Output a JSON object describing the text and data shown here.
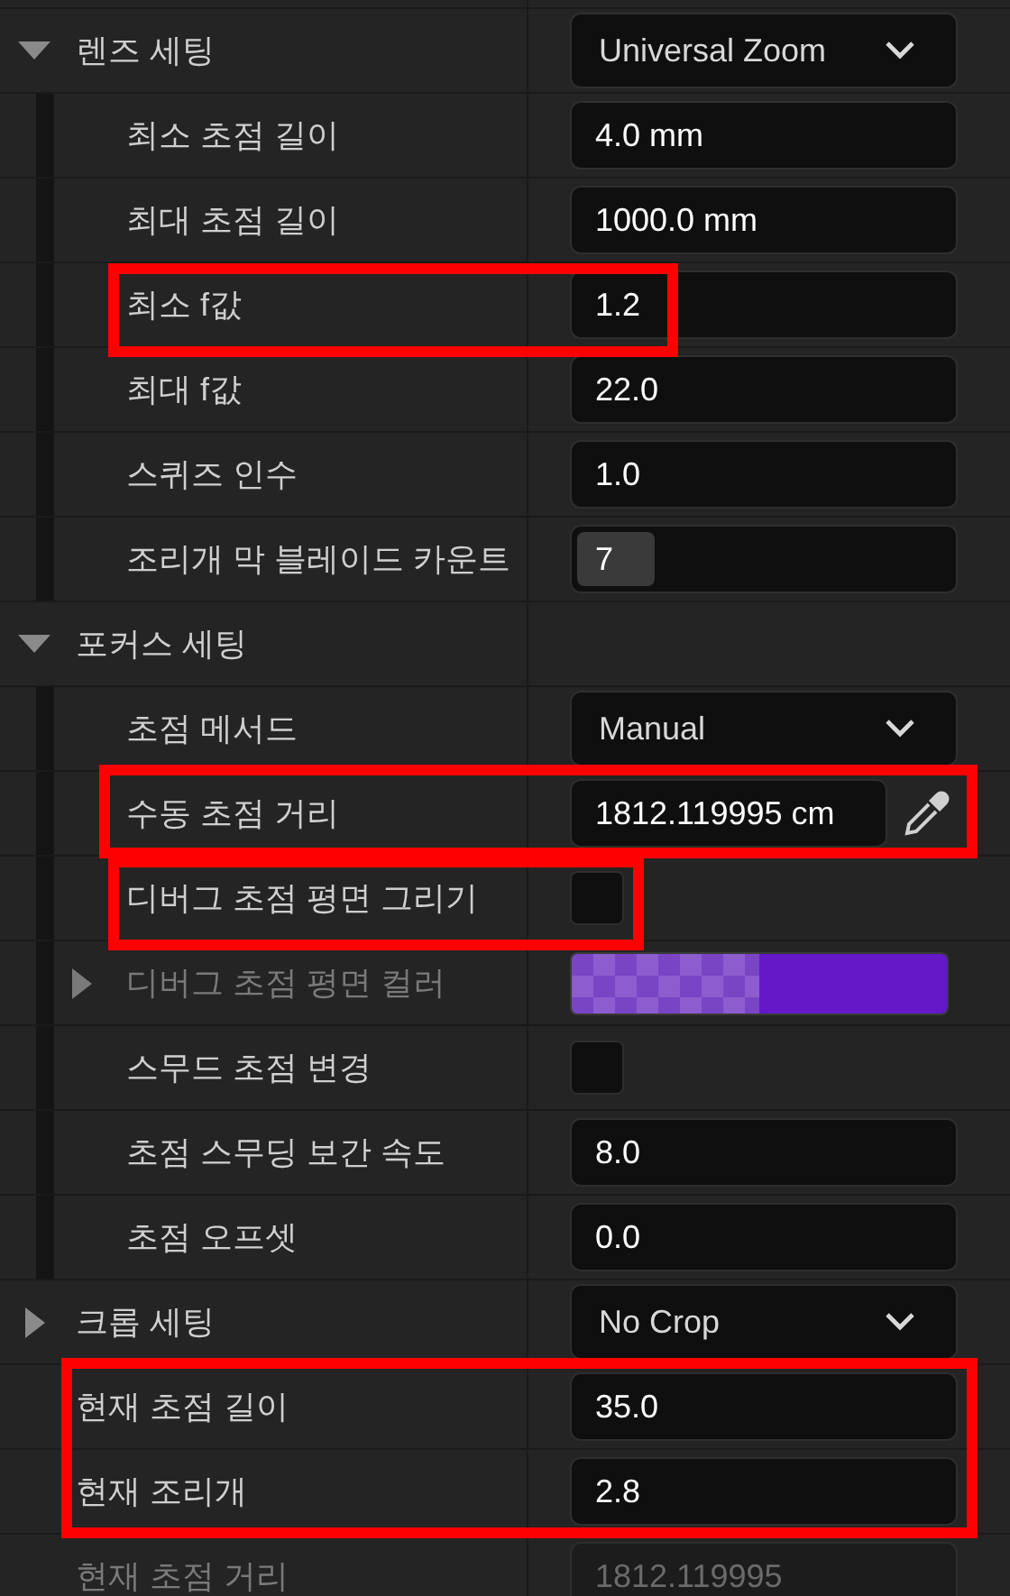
{
  "items": [
    {
      "kind": "section",
      "label": "렌즈 세팅",
      "expanded": true,
      "value": {
        "kind": "dropdown",
        "text": "Universal Zoom"
      },
      "rows": [
        {
          "label": "최소 초점 길이",
          "kind": "text",
          "value": "4.0 mm",
          "disabled": false,
          "highlighted": false
        },
        {
          "label": "최대 초점 길이",
          "kind": "text",
          "value": "1000.0 mm",
          "disabled": false,
          "highlighted": false
        },
        {
          "label": "최소 f값",
          "kind": "text",
          "value": "1.2",
          "disabled": false,
          "highlighted": true
        },
        {
          "label": "최대 f값",
          "kind": "text",
          "value": "22.0",
          "disabled": false,
          "highlighted": false
        },
        {
          "label": "스퀴즈 인수",
          "kind": "text",
          "value": "1.0",
          "disabled": false,
          "highlighted": false
        },
        {
          "label": "조리개 막 블레이드 카운트",
          "kind": "slider",
          "value": "7",
          "level": 0.2,
          "disabled": false,
          "highlighted": false
        }
      ]
    },
    {
      "kind": "section",
      "label": "포커스 세팅",
      "expanded": true,
      "rows": [
        {
          "label": "초점 메서드",
          "kind": "dropdown",
          "value": "Manual",
          "disabled": false,
          "highlighted": false
        },
        {
          "label": "수동 초점 거리",
          "kind": "eyedropper",
          "value": "1812.119995 cm",
          "disabled": false,
          "highlighted": true
        },
        {
          "label": "디버그 초점 평면 그리기",
          "kind": "checkbox",
          "checked": false,
          "disabled": false,
          "highlighted": true
        },
        {
          "label": "디버그 초점 평면 컬러",
          "kind": "color",
          "color": "#6418c8",
          "expanded": false,
          "disabled": true,
          "highlighted": false
        },
        {
          "label": "스무드 초점 변경",
          "kind": "checkbox",
          "checked": false,
          "disabled": false,
          "highlighted": false
        },
        {
          "label": "초점 스무딩 보간 속도",
          "kind": "text",
          "value": "8.0",
          "disabled": false,
          "highlighted": false
        },
        {
          "label": "초점 오프셋",
          "kind": "text",
          "value": "0.0",
          "disabled": false,
          "highlighted": false
        }
      ]
    },
    {
      "kind": "section",
      "label": "크롭 세팅",
      "expanded": false,
      "value": {
        "kind": "dropdown",
        "text": "No Crop"
      }
    },
    {
      "label": "현재 초점 길이",
      "kind": "text",
      "value": "35.0",
      "disabled": false,
      "highlighted": true
    },
    {
      "label": "현재 조리개",
      "kind": "text",
      "value": "2.8",
      "disabled": false,
      "highlighted": true
    },
    {
      "label": "현재 초점 거리",
      "kind": "text",
      "value": "1812.119995",
      "disabled": true,
      "highlighted": false
    }
  ]
}
